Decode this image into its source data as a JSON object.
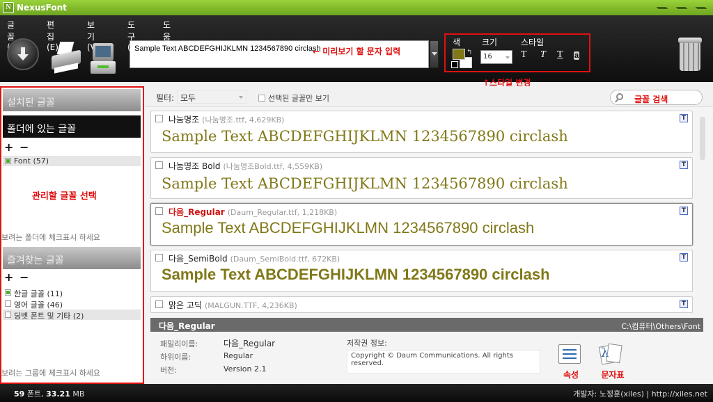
{
  "app": {
    "title": "NexusFont",
    "logo_letter": "N"
  },
  "menu": [
    "글꼴(F)",
    "편집(E)",
    "보기(V)",
    "도구(T)",
    "도움말(H)"
  ],
  "toolbar": {
    "sample_text": "Sample Text ABCDEFGHIJKLMN 1234567890 circlash",
    "sample_hint": "← 미리보기 할 문자 입력",
    "color_label": "색",
    "size_label": "크기",
    "style_label": "스타일",
    "size_value": "16",
    "style_buttons": [
      "T",
      "T",
      "T",
      "a"
    ],
    "style_note": "↑스타일 변경",
    "fg_color": "#807818",
    "bg_color": "#ffffff"
  },
  "sidebar": {
    "installed_header": "설치된 글꼴",
    "folder_header": "폴더에 있는 글꼴",
    "folder_items": [
      {
        "label": "Font (57)",
        "checked": true
      }
    ],
    "manage_note": "관리할 글꼴 선택",
    "folder_hint": "보려는 폴더에 체크표시 하세요",
    "favorites_header": "즐겨찾는 글꼴",
    "favorite_items": [
      {
        "label": "한글 글꼴 (11)",
        "checked": true
      },
      {
        "label": "영어 글꼴 (46)",
        "checked": false
      },
      {
        "label": "딩벳 폰트 및 기타 (2)",
        "checked": false
      }
    ],
    "group_hint": "보려는 그룹에 체크표시 하세요",
    "plus": "+",
    "minus": "−"
  },
  "filter": {
    "label": "필터:",
    "value": "모두",
    "only_selected": "선택된 글꼴만 보기",
    "search_label": "글꼴 검색"
  },
  "fonts": [
    {
      "name": "나눔명조",
      "meta": "(나눔명조.ttf, 4,629KB)",
      "sample": "Sample Text ABCDEFGHIJKLMN 1234567890 circlash",
      "selected": false
    },
    {
      "name": "나눔명조 Bold",
      "meta": "(나눔명조Bold.ttf, 4,559KB)",
      "sample": "Sample Text ABCDEFGHIJKLMN 1234567890 circlash",
      "selected": false
    },
    {
      "name": "다음_Regular",
      "meta": "(Daum_Regular.ttf, 1,218KB)",
      "sample": "Sample Text ABCDEFGHIJKLMN 1234567890 circlash",
      "selected": true
    },
    {
      "name": "다음_SemiBold",
      "meta": "(Daum_SemiBold.ttf, 672KB)",
      "sample": "Sample Text ABCDEFGHIJKLMN 1234567890 circlash",
      "selected": false
    },
    {
      "name": "맑은 고딕",
      "meta": "(MALGUN.TTF, 4,236KB)",
      "sample": "",
      "selected": false
    }
  ],
  "details": {
    "title": "다음_Regular",
    "path": "C:\\컴퓨터\\Others\\Font",
    "family_label": "패밀리이름:",
    "family_value": "다음_Regular",
    "sub_label": "하위이름:",
    "sub_value": "Regular",
    "version_label": "버전:",
    "version_value": "Version 2.1",
    "copyright_label": "저작권 정보:",
    "copyright_value": "Copyright © Daum Communications. All rights reserved.",
    "prop_button": "속성",
    "charmap_button": "문자표"
  },
  "status": {
    "count": "59",
    "count_unit": "폰트,",
    "size": "33.21",
    "size_unit": "MB",
    "developer": "개발자: 노정훈(xiles)  |  http://xiles.net"
  }
}
